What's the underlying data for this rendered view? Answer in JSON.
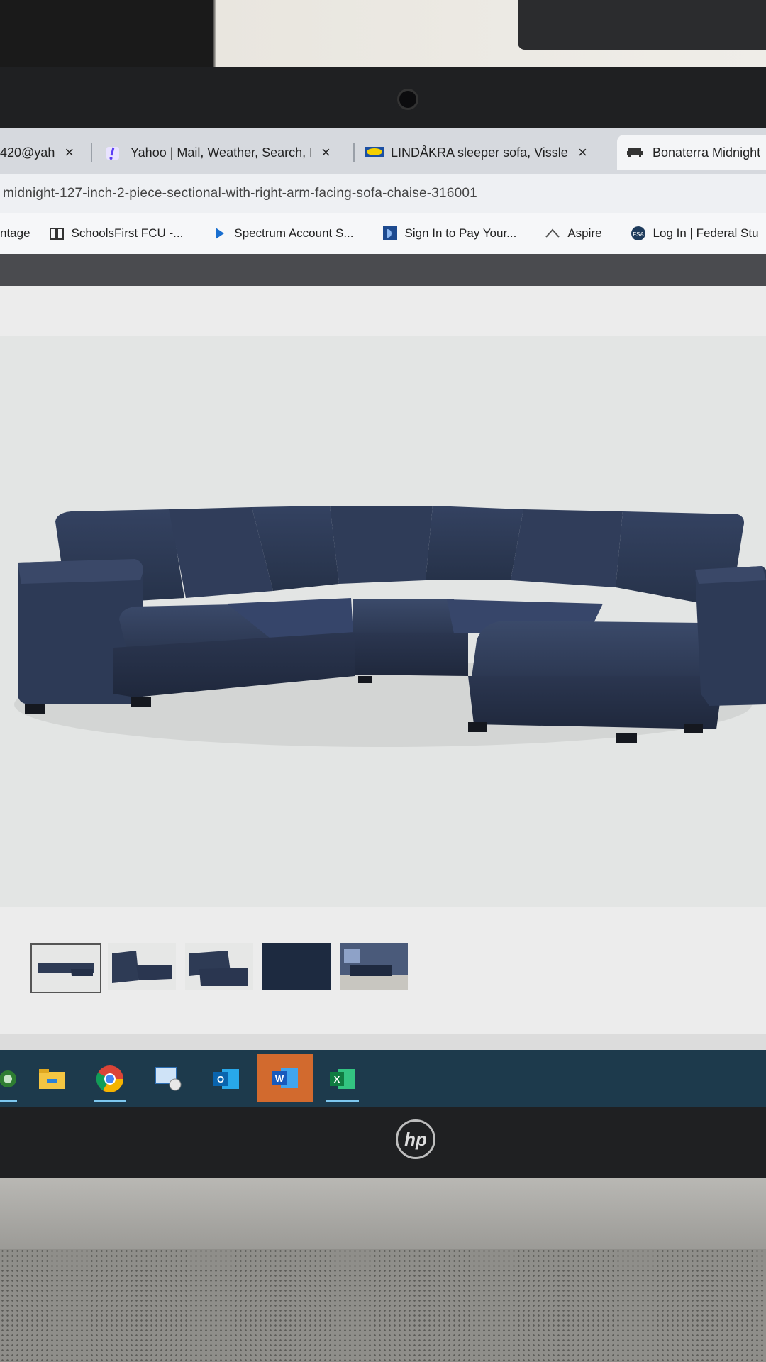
{
  "browser": {
    "tabs": [
      {
        "title": "420@yah",
        "close": "×"
      },
      {
        "title": "Yahoo | Mail, Weather, Search, F",
        "close": "×"
      },
      {
        "title": "LINDÅKRA sleeper sofa, Vissle d",
        "close": "×"
      },
      {
        "title": "Bonaterra Midnight"
      }
    ],
    "url": "midnight-127-inch-2-piece-sectional-with-right-arm-facing-sofa-chaise-316001",
    "bookmarks": [
      {
        "label": "ntage"
      },
      {
        "label": "SchoolsFirst FCU -..."
      },
      {
        "label": "Spectrum Account S..."
      },
      {
        "label": "Sign In to Pay Your..."
      },
      {
        "label": "Aspire"
      },
      {
        "label": "Log In | Federal Stu"
      }
    ]
  },
  "product": {
    "thumbnails": [
      "sectional-front",
      "sectional-angle",
      "sectional-side",
      "fabric-swatch",
      "room-scene"
    ],
    "selected_thumbnail": 0,
    "fabric_color": "#2e3b55"
  },
  "taskbar": {
    "apps": [
      "status-app",
      "file-explorer",
      "chrome",
      "remote-desktop",
      "outlook",
      "word",
      "excel"
    ]
  },
  "device": {
    "brand": "hp"
  }
}
